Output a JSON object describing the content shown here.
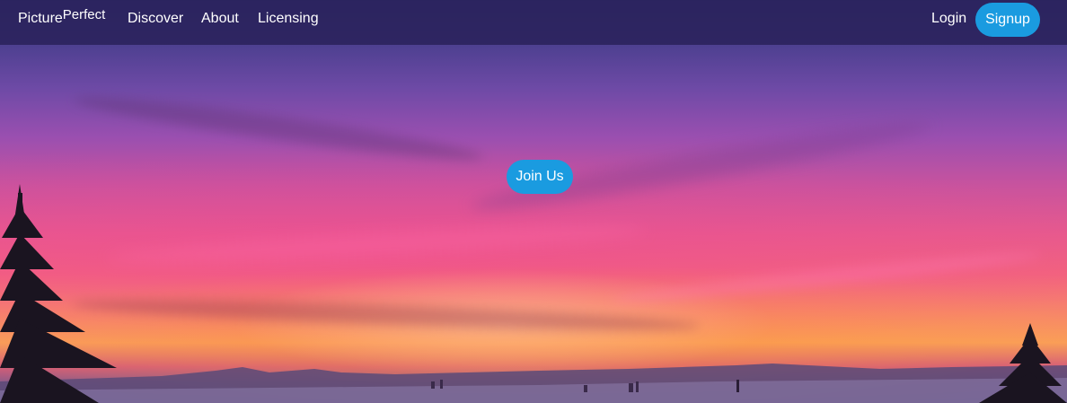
{
  "brand": {
    "name": "Picture",
    "superscript": "Perfect"
  },
  "nav": {
    "links": [
      "Discover",
      "About",
      "Licensing"
    ],
    "login_label": "Login",
    "signup_label": "Signup"
  },
  "hero": {
    "cta_label": "Join Us"
  },
  "colors": {
    "accent": "#1a9be0",
    "navbar": "#282058",
    "text": "#ffffff"
  }
}
